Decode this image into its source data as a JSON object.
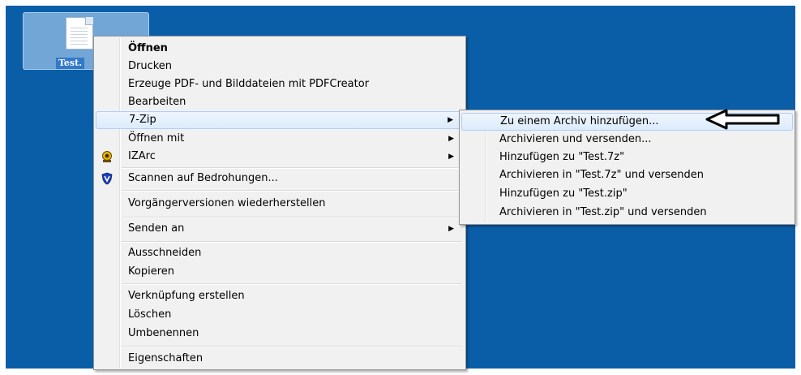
{
  "desktop": {
    "file_label": "Test."
  },
  "context_menu": {
    "items": [
      {
        "label": "Öffnen"
      },
      {
        "label": "Drucken"
      },
      {
        "label": "Erzeuge PDF- und Bilddateien mit PDFCreator"
      },
      {
        "label": "Bearbeiten"
      },
      {
        "label": "7-Zip"
      },
      {
        "label": "Öffnen mit"
      },
      {
        "label": "IZArc"
      },
      {
        "label": "Scannen auf Bedrohungen..."
      },
      {
        "label": "Vorgängerversionen wiederherstellen"
      },
      {
        "label": "Senden an"
      },
      {
        "label": "Ausschneiden"
      },
      {
        "label": "Kopieren"
      },
      {
        "label": "Verknüpfung erstellen"
      },
      {
        "label": "Löschen"
      },
      {
        "label": "Umbenennen"
      },
      {
        "label": "Eigenschaften"
      }
    ],
    "submenu_glyph": "▶"
  },
  "submenu_7zip": {
    "items": [
      {
        "label": "Zu einem Archiv hinzufügen..."
      },
      {
        "label": "Archivieren und versenden..."
      },
      {
        "label": "Hinzufügen zu \"Test.7z\""
      },
      {
        "label": "Archivieren in \"Test.7z\" und versenden"
      },
      {
        "label": "Hinzufügen zu \"Test.zip\""
      },
      {
        "label": "Archivieren in \"Test.zip\" und versenden"
      }
    ]
  },
  "colors": {
    "desktop_bg": "#0a5ea8",
    "menu_bg": "#f1f1f1",
    "highlight_border": "#aecff7"
  },
  "icons": [
    "document-icon",
    "izarc-icon",
    "shield-icon",
    "arrow-annotation-icon"
  ]
}
